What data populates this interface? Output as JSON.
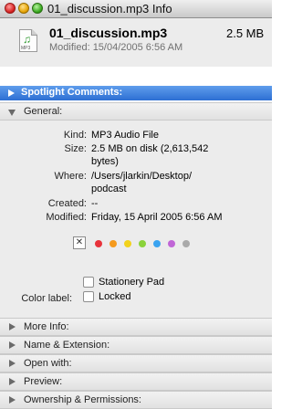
{
  "window": {
    "title": "01_discussion.mp3 Info"
  },
  "file": {
    "icon": "mp3-file-icon",
    "icon_ext": "MP3",
    "name": "01_discussion.mp3",
    "size": "2.5 MB",
    "modified": "Modified: 15/04/2005 6:56 AM"
  },
  "spotlight": {
    "label": "Spotlight Comments:"
  },
  "general": {
    "header": "General:",
    "kind_label": "Kind:",
    "kind_value": "MP3 Audio File",
    "size_label": "Size:",
    "size_value_line1": "2.5 MB on disk (2,613,542",
    "size_value_line2": "bytes)",
    "where_label": "Where:",
    "where_value_line1": "/Users/jlarkin/Desktop/",
    "where_value_line2": "podcast",
    "created_label": "Created:",
    "created_value": "--",
    "modified_label": "Modified:",
    "modified_value": "Friday, 15 April 2005 6:56 AM",
    "color_label": "Color label:",
    "color_none": "✕",
    "label_colors": [
      "#e8333b",
      "#f59a1d",
      "#f2d21b",
      "#8ad23a",
      "#3aa3f0",
      "#c066d6",
      "#a9a9a9"
    ],
    "stationery_label": "Stationery Pad",
    "locked_label": "Locked"
  },
  "sections": [
    {
      "label": "More Info:"
    },
    {
      "label": "Name & Extension:"
    },
    {
      "label": "Open with:"
    },
    {
      "label": "Preview:"
    },
    {
      "label": "Ownership & Permissions:"
    }
  ]
}
